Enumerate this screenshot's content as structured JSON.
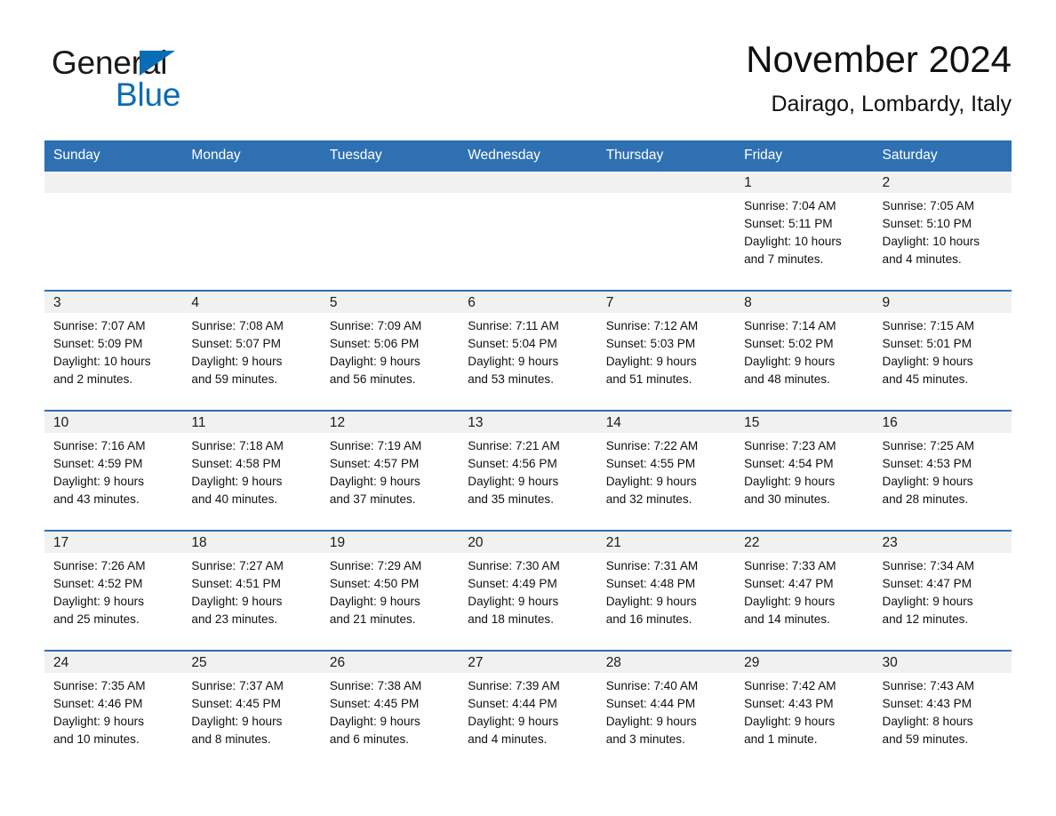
{
  "logo": {
    "word_dark": "General",
    "word_blue": "Blue",
    "triangle_color": "#0b6cb6"
  },
  "header": {
    "title": "November 2024",
    "subtitle": "Dairago, Lombardy, Italy"
  },
  "theme": {
    "header_blue": "#2e70b2",
    "daynum_band": "#f1f1f1",
    "text": "#111111"
  },
  "weekday_headers": [
    "Sunday",
    "Monday",
    "Tuesday",
    "Wednesday",
    "Thursday",
    "Friday",
    "Saturday"
  ],
  "weeks": [
    [
      {
        "day": "",
        "lines": []
      },
      {
        "day": "",
        "lines": []
      },
      {
        "day": "",
        "lines": []
      },
      {
        "day": "",
        "lines": []
      },
      {
        "day": "",
        "lines": []
      },
      {
        "day": "1",
        "lines": [
          "Sunrise: 7:04 AM",
          "Sunset: 5:11 PM",
          "Daylight: 10 hours",
          "and 7 minutes."
        ]
      },
      {
        "day": "2",
        "lines": [
          "Sunrise: 7:05 AM",
          "Sunset: 5:10 PM",
          "Daylight: 10 hours",
          "and 4 minutes."
        ]
      }
    ],
    [
      {
        "day": "3",
        "lines": [
          "Sunrise: 7:07 AM",
          "Sunset: 5:09 PM",
          "Daylight: 10 hours",
          "and 2 minutes."
        ]
      },
      {
        "day": "4",
        "lines": [
          "Sunrise: 7:08 AM",
          "Sunset: 5:07 PM",
          "Daylight: 9 hours",
          "and 59 minutes."
        ]
      },
      {
        "day": "5",
        "lines": [
          "Sunrise: 7:09 AM",
          "Sunset: 5:06 PM",
          "Daylight: 9 hours",
          "and 56 minutes."
        ]
      },
      {
        "day": "6",
        "lines": [
          "Sunrise: 7:11 AM",
          "Sunset: 5:04 PM",
          "Daylight: 9 hours",
          "and 53 minutes."
        ]
      },
      {
        "day": "7",
        "lines": [
          "Sunrise: 7:12 AM",
          "Sunset: 5:03 PM",
          "Daylight: 9 hours",
          "and 51 minutes."
        ]
      },
      {
        "day": "8",
        "lines": [
          "Sunrise: 7:14 AM",
          "Sunset: 5:02 PM",
          "Daylight: 9 hours",
          "and 48 minutes."
        ]
      },
      {
        "day": "9",
        "lines": [
          "Sunrise: 7:15 AM",
          "Sunset: 5:01 PM",
          "Daylight: 9 hours",
          "and 45 minutes."
        ]
      }
    ],
    [
      {
        "day": "10",
        "lines": [
          "Sunrise: 7:16 AM",
          "Sunset: 4:59 PM",
          "Daylight: 9 hours",
          "and 43 minutes."
        ]
      },
      {
        "day": "11",
        "lines": [
          "Sunrise: 7:18 AM",
          "Sunset: 4:58 PM",
          "Daylight: 9 hours",
          "and 40 minutes."
        ]
      },
      {
        "day": "12",
        "lines": [
          "Sunrise: 7:19 AM",
          "Sunset: 4:57 PM",
          "Daylight: 9 hours",
          "and 37 minutes."
        ]
      },
      {
        "day": "13",
        "lines": [
          "Sunrise: 7:21 AM",
          "Sunset: 4:56 PM",
          "Daylight: 9 hours",
          "and 35 minutes."
        ]
      },
      {
        "day": "14",
        "lines": [
          "Sunrise: 7:22 AM",
          "Sunset: 4:55 PM",
          "Daylight: 9 hours",
          "and 32 minutes."
        ]
      },
      {
        "day": "15",
        "lines": [
          "Sunrise: 7:23 AM",
          "Sunset: 4:54 PM",
          "Daylight: 9 hours",
          "and 30 minutes."
        ]
      },
      {
        "day": "16",
        "lines": [
          "Sunrise: 7:25 AM",
          "Sunset: 4:53 PM",
          "Daylight: 9 hours",
          "and 28 minutes."
        ]
      }
    ],
    [
      {
        "day": "17",
        "lines": [
          "Sunrise: 7:26 AM",
          "Sunset: 4:52 PM",
          "Daylight: 9 hours",
          "and 25 minutes."
        ]
      },
      {
        "day": "18",
        "lines": [
          "Sunrise: 7:27 AM",
          "Sunset: 4:51 PM",
          "Daylight: 9 hours",
          "and 23 minutes."
        ]
      },
      {
        "day": "19",
        "lines": [
          "Sunrise: 7:29 AM",
          "Sunset: 4:50 PM",
          "Daylight: 9 hours",
          "and 21 minutes."
        ]
      },
      {
        "day": "20",
        "lines": [
          "Sunrise: 7:30 AM",
          "Sunset: 4:49 PM",
          "Daylight: 9 hours",
          "and 18 minutes."
        ]
      },
      {
        "day": "21",
        "lines": [
          "Sunrise: 7:31 AM",
          "Sunset: 4:48 PM",
          "Daylight: 9 hours",
          "and 16 minutes."
        ]
      },
      {
        "day": "22",
        "lines": [
          "Sunrise: 7:33 AM",
          "Sunset: 4:47 PM",
          "Daylight: 9 hours",
          "and 14 minutes."
        ]
      },
      {
        "day": "23",
        "lines": [
          "Sunrise: 7:34 AM",
          "Sunset: 4:47 PM",
          "Daylight: 9 hours",
          "and 12 minutes."
        ]
      }
    ],
    [
      {
        "day": "24",
        "lines": [
          "Sunrise: 7:35 AM",
          "Sunset: 4:46 PM",
          "Daylight: 9 hours",
          "and 10 minutes."
        ]
      },
      {
        "day": "25",
        "lines": [
          "Sunrise: 7:37 AM",
          "Sunset: 4:45 PM",
          "Daylight: 9 hours",
          "and 8 minutes."
        ]
      },
      {
        "day": "26",
        "lines": [
          "Sunrise: 7:38 AM",
          "Sunset: 4:45 PM",
          "Daylight: 9 hours",
          "and 6 minutes."
        ]
      },
      {
        "day": "27",
        "lines": [
          "Sunrise: 7:39 AM",
          "Sunset: 4:44 PM",
          "Daylight: 9 hours",
          "and 4 minutes."
        ]
      },
      {
        "day": "28",
        "lines": [
          "Sunrise: 7:40 AM",
          "Sunset: 4:44 PM",
          "Daylight: 9 hours",
          "and 3 minutes."
        ]
      },
      {
        "day": "29",
        "lines": [
          "Sunrise: 7:42 AM",
          "Sunset: 4:43 PM",
          "Daylight: 9 hours",
          "and 1 minute."
        ]
      },
      {
        "day": "30",
        "lines": [
          "Sunrise: 7:43 AM",
          "Sunset: 4:43 PM",
          "Daylight: 8 hours",
          "and 59 minutes."
        ]
      }
    ]
  ]
}
